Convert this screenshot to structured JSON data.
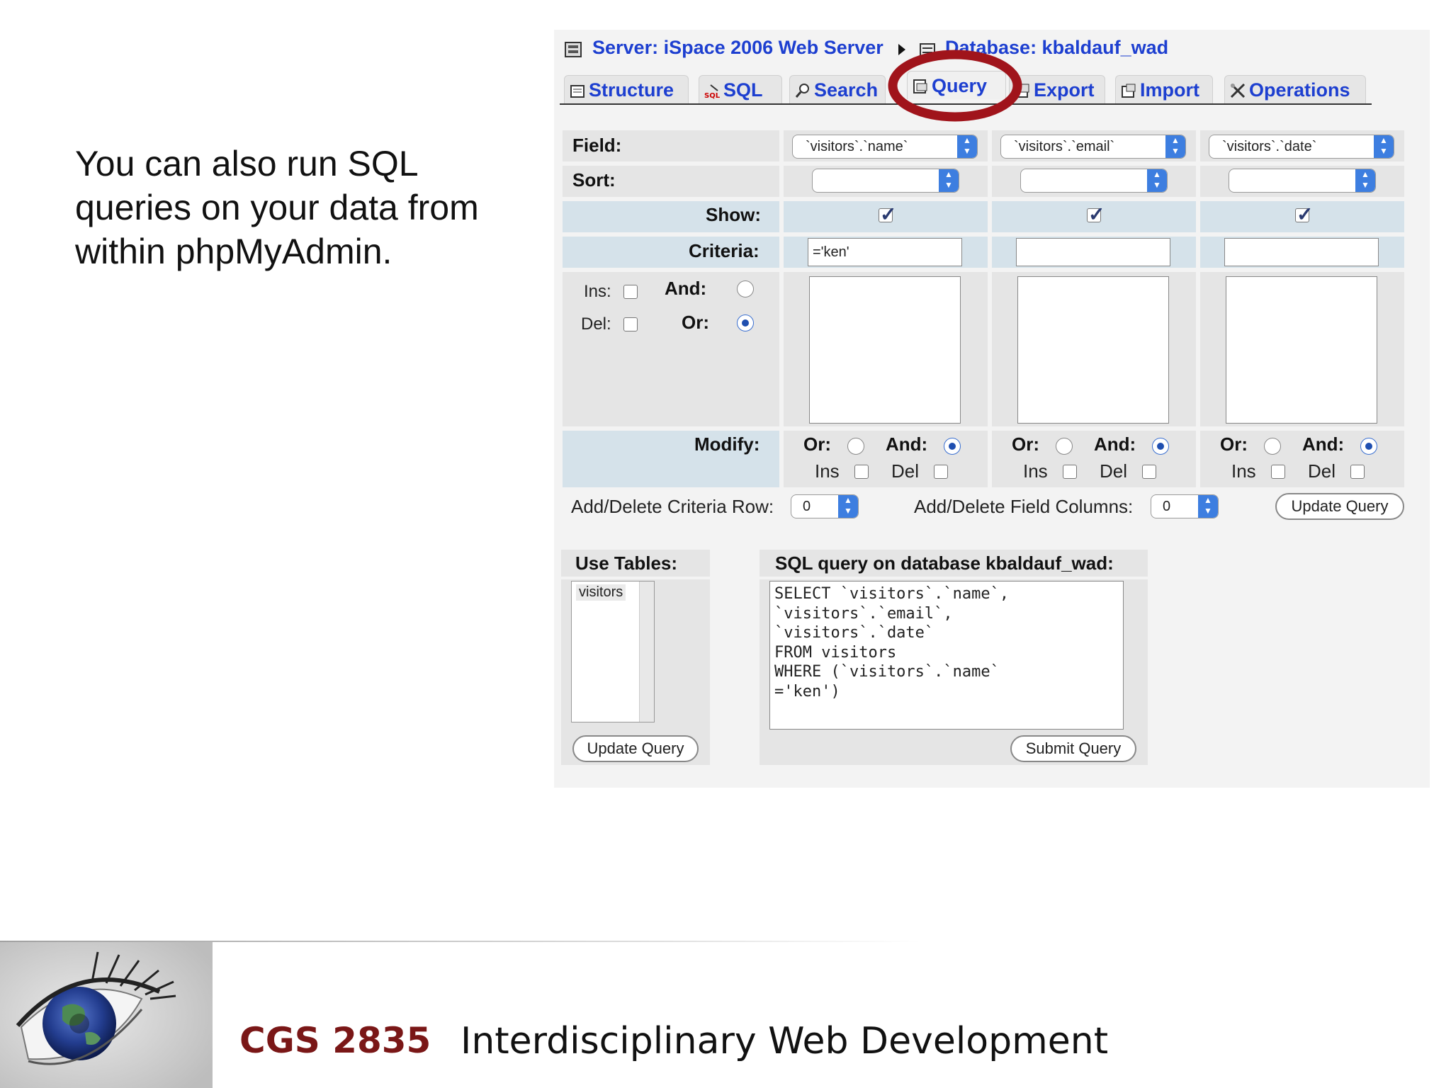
{
  "slide": {
    "text": "You can also run SQL queries on your data from within phpMyAdmin."
  },
  "breadcrumb": {
    "server": "Server: iSpace 2006 Web Server",
    "database": "Database: kbaldauf_wad"
  },
  "tabs": [
    {
      "label": "Structure",
      "icon": "structure-icon"
    },
    {
      "label": "SQL",
      "icon": "sql-icon"
    },
    {
      "label": "Search",
      "icon": "search-icon"
    },
    {
      "label": "Query",
      "icon": "query-icon",
      "active": true
    },
    {
      "label": "Export",
      "icon": "export-icon"
    },
    {
      "label": "Import",
      "icon": "import-icon"
    },
    {
      "label": "Operations",
      "icon": "operations-icon"
    }
  ],
  "grid": {
    "labels": {
      "field": "Field:",
      "sort": "Sort:",
      "show": "Show:",
      "criteria": "Criteria:",
      "ins": "Ins:",
      "del": "Del:",
      "and": "And:",
      "or": "Or:",
      "modify": "Modify:"
    },
    "modify_labels": {
      "or": "Or:",
      "and": "And:",
      "ins": "Ins",
      "del": "Del"
    },
    "columns": [
      {
        "field": "`visitors`.`name`",
        "sort": "",
        "show": true,
        "criteria": "='ken'"
      },
      {
        "field": "`visitors`.`email`",
        "sort": "",
        "show": true,
        "criteria": ""
      },
      {
        "field": "`visitors`.`date`",
        "sort": "",
        "show": true,
        "criteria": ""
      }
    ]
  },
  "controls": {
    "criteria_row_label": "Add/Delete Criteria Row:",
    "criteria_row_value": "0",
    "field_columns_label": "Add/Delete Field Columns:",
    "field_columns_value": "0",
    "update_query": "Update Query"
  },
  "use_tables": {
    "title": "Use Tables:",
    "items": [
      "visitors"
    ],
    "button": "Update Query"
  },
  "sql_query": {
    "title": "SQL query on database kbaldauf_wad:",
    "text": "SELECT `visitors`.`name`,\n`visitors`.`email`,\n`visitors`.`date`\nFROM visitors\nWHERE (`visitors`.`name`\n='ken')",
    "button": "Submit Query"
  },
  "highlight_color": "#a0141b",
  "footer": {
    "course_code": "CGS 2835",
    "course_name": "Interdisciplinary Web Development"
  }
}
